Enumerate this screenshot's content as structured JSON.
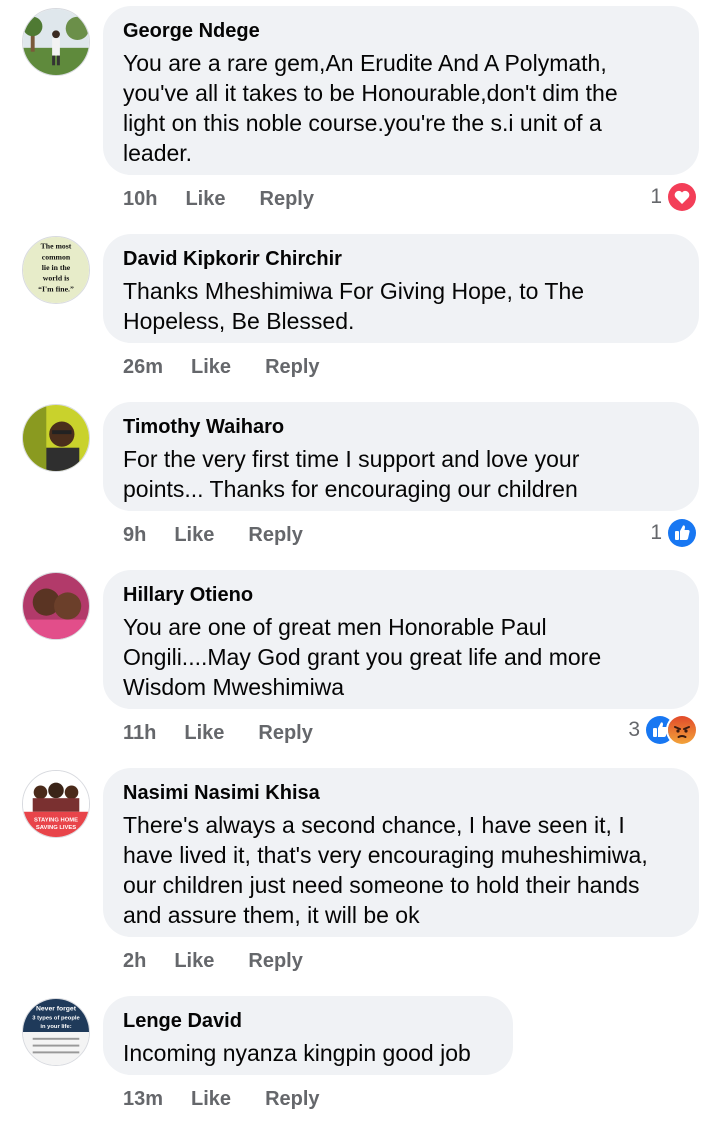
{
  "actions": {
    "like_label": "Like",
    "reply_label": "Reply"
  },
  "comments": [
    {
      "author": "George Ndege",
      "text_lines": [
        "You are a rare gem,An Erudite And A Polymath,",
        "you've all it takes to be Honourable,don't dim the",
        "light on this noble course.you're the s.i unit of a",
        "leader."
      ],
      "time": "10h",
      "reaction_count": "1",
      "reactions": [
        "love-icon"
      ]
    },
    {
      "author": "David Kipkorir Chirchir",
      "text_lines": [
        "Thanks Mheshimiwa For Giving Hope, to The",
        "Hopeless, Be Blessed."
      ],
      "time": "26m",
      "avatar_text": [
        "The most",
        "common",
        "lie in the",
        "world is",
        "“I'm fine.”"
      ]
    },
    {
      "author": "Timothy Waiharo",
      "text_lines": [
        "For the very first time I support and love your",
        "points... Thanks for encouraging our children"
      ],
      "time": "9h",
      "reaction_count": "1",
      "reactions": [
        "like-icon"
      ]
    },
    {
      "author": "Hillary Otieno",
      "text_lines": [
        "You are one of great men Honorable Paul",
        "Ongili....May God grant you great life and more",
        "Wisdom Mweshimiwa"
      ],
      "time": "11h",
      "reaction_count": "3",
      "reactions": [
        "like-icon",
        "angry-icon"
      ]
    },
    {
      "author": "Nasimi Nasimi Khisa",
      "text_lines": [
        "There's always a second chance, I have seen it, I",
        "have lived it, that's very encouraging muheshimiwa,",
        "our children just need someone to hold their hands",
        "and assure them, it will be ok"
      ],
      "time": "2h",
      "avatar_text": [
        "STAYING HOME",
        "SAVING LIVES"
      ]
    },
    {
      "author": "Lenge David",
      "text_lines": [
        "Incoming nyanza kingpin good job"
      ],
      "time": "13m",
      "avatar_text": [
        "Never forget",
        "3 types of people",
        "in your life:"
      ]
    }
  ],
  "colors": {
    "bubble": "#f0f2f5",
    "meta_text": "#65676b",
    "like_blue": "#1877f2",
    "love_red": "#f33e58",
    "angry_orange": "#e9710f"
  }
}
